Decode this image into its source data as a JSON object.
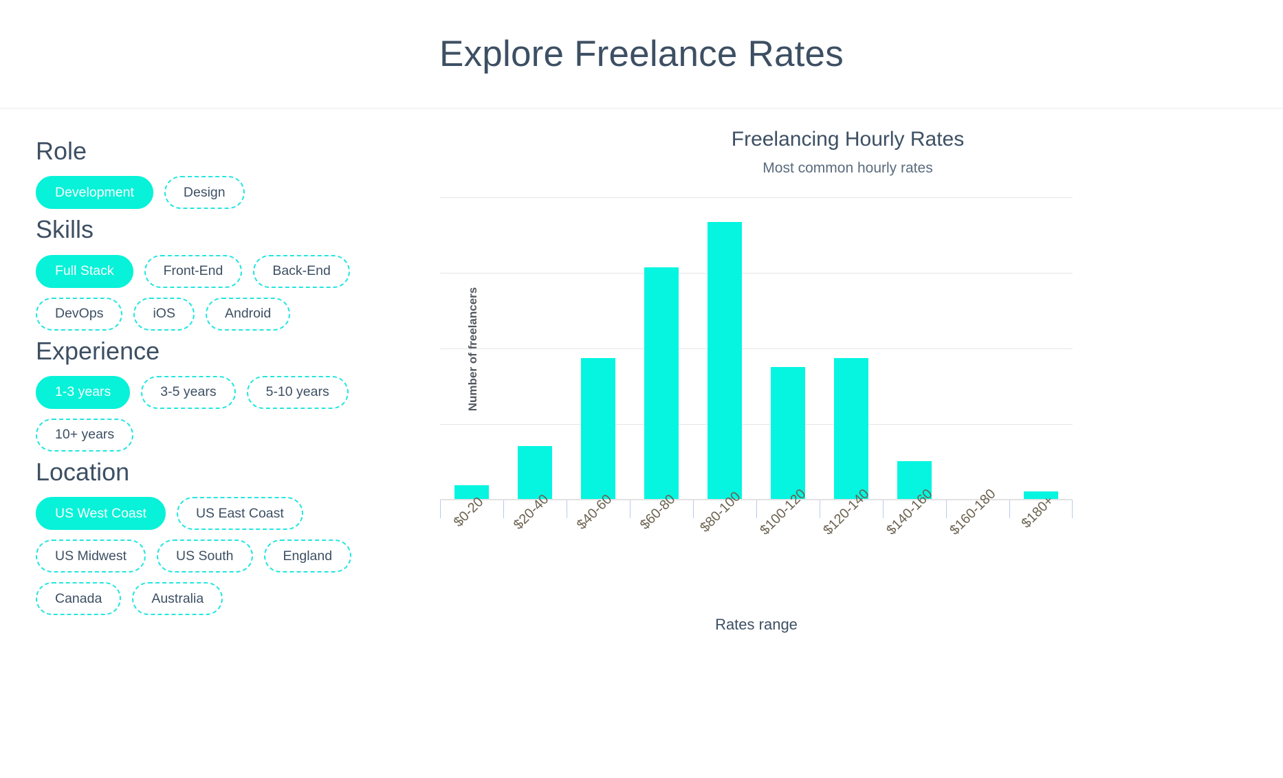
{
  "header": {
    "title": "Explore Freelance Rates"
  },
  "sidebar": {
    "groups": [
      {
        "title": "Role",
        "options": [
          {
            "label": "Development",
            "selected": true
          },
          {
            "label": "Design",
            "selected": false
          }
        ]
      },
      {
        "title": "Skills",
        "options": [
          {
            "label": "Full Stack",
            "selected": true
          },
          {
            "label": "Front-End",
            "selected": false
          },
          {
            "label": "Back-End",
            "selected": false
          },
          {
            "label": "DevOps",
            "selected": false
          },
          {
            "label": "iOS",
            "selected": false
          },
          {
            "label": "Android",
            "selected": false
          }
        ]
      },
      {
        "title": "Experience",
        "options": [
          {
            "label": "1-3 years",
            "selected": true
          },
          {
            "label": "3-5 years",
            "selected": false
          },
          {
            "label": "5-10 years",
            "selected": false
          },
          {
            "label": "10+ years",
            "selected": false
          }
        ]
      },
      {
        "title": "Location",
        "options": [
          {
            "label": "US West Coast",
            "selected": true
          },
          {
            "label": "US East Coast",
            "selected": false
          },
          {
            "label": "US Midwest",
            "selected": false
          },
          {
            "label": "US South",
            "selected": false
          },
          {
            "label": "England",
            "selected": false
          },
          {
            "label": "Canada",
            "selected": false
          },
          {
            "label": "Australia",
            "selected": false
          }
        ]
      }
    ]
  },
  "colors": {
    "accent": "#07f2d8",
    "accent_dashed_border": "#22e6e0",
    "bar_fill": "#05f5e0",
    "heading_text": "#3d4f63",
    "tick_label": "#6b6250",
    "gridline": "#e6e6e6"
  },
  "chart_data": {
    "type": "bar",
    "title": "Freelancing Hourly Rates",
    "subtitle": "Most common hourly rates",
    "xlabel": "Rates range",
    "ylabel": "Number of freelancers",
    "categories": [
      "$0-20",
      "$20-40",
      "$40-60",
      "$60-80",
      "$80-100",
      "$100-120",
      "$120-140",
      "$140-160",
      "$160-180",
      "$180+"
    ],
    "values": [
      5,
      18,
      47,
      77,
      92,
      44,
      47,
      13,
      0,
      3
    ],
    "ylim": [
      0,
      100
    ],
    "gridlines_at": [
      25,
      50,
      75,
      100
    ],
    "grid": true,
    "legend": "none"
  }
}
